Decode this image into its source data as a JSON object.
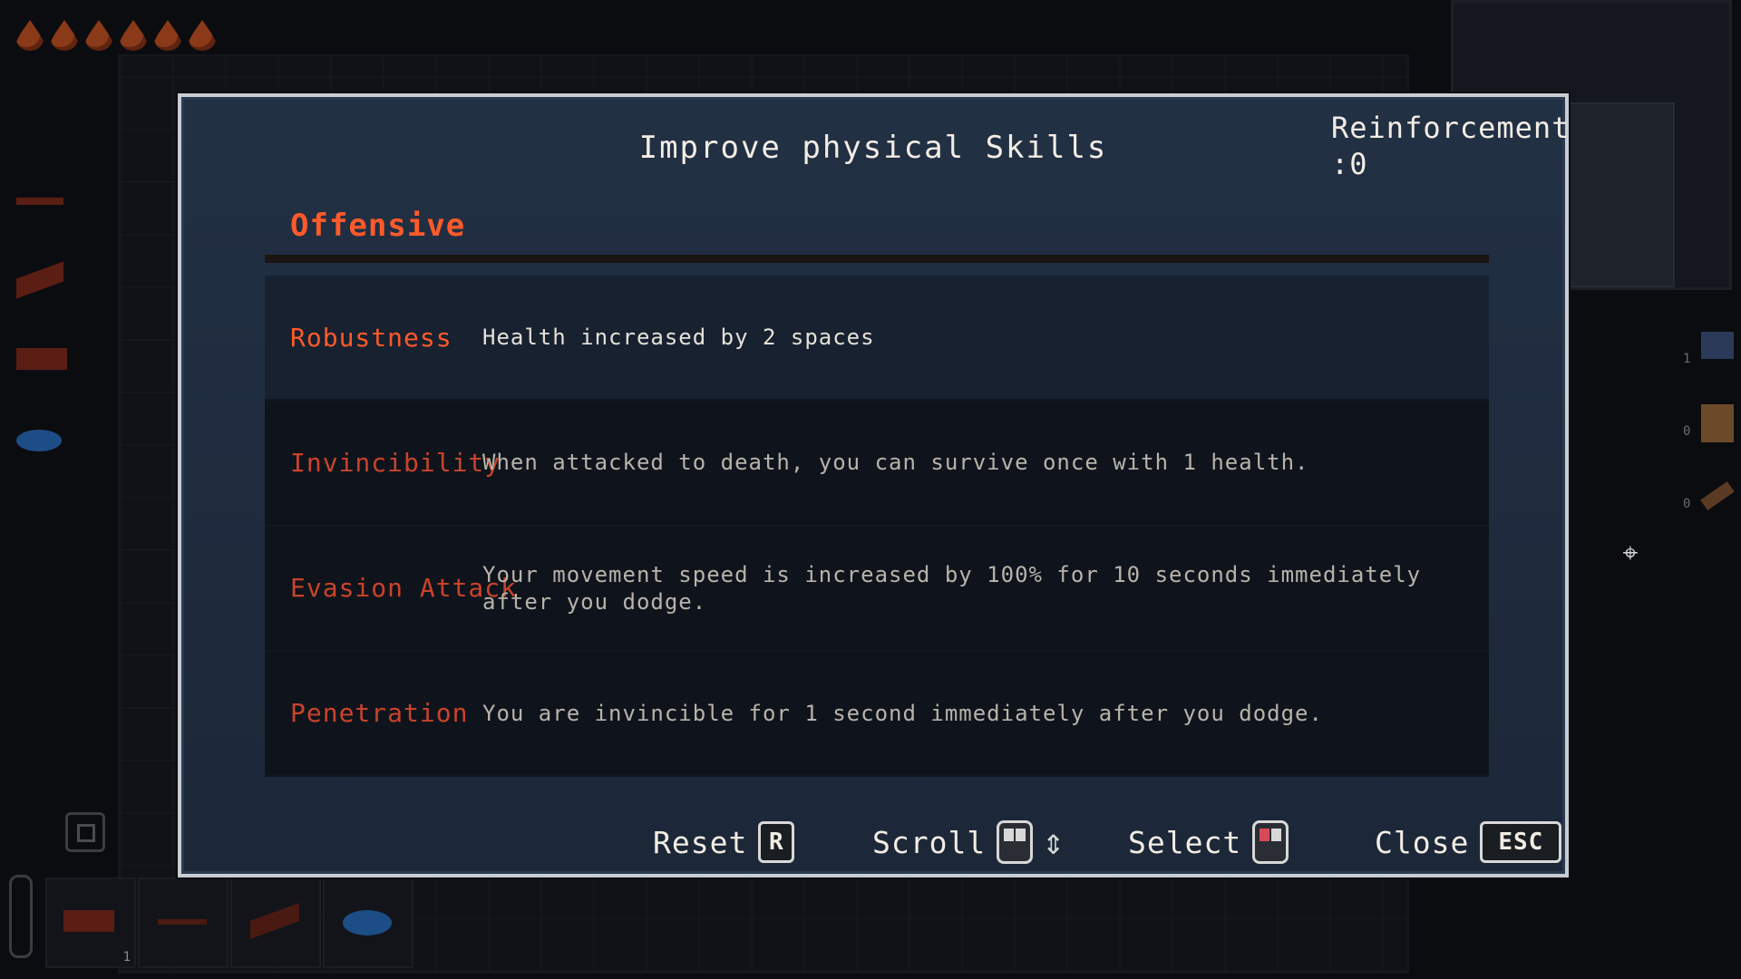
{
  "modal": {
    "title": "Improve physical Skills",
    "reinforcement_label": "Reinforcement",
    "reinforcement_value": ":0"
  },
  "section": {
    "title": "Offensive"
  },
  "skills": [
    {
      "name": "Robustness",
      "description": "Health increased by 2 spaces"
    },
    {
      "name": "Invincibility",
      "description": "When attacked to death, you can survive once with 1 health."
    },
    {
      "name": "Evasion Attack",
      "description": "Your movement speed is increased by 100% for 10 seconds immediately after you dodge."
    },
    {
      "name": "Penetration",
      "description": "You are invincible for 1 second immediately after you dodge."
    }
  ],
  "controls": {
    "reset_label": "Reset",
    "reset_key": "R",
    "scroll_label": "Scroll",
    "select_label": "Select",
    "close_label": "Close",
    "close_key": "ESC"
  },
  "hud": {
    "hearts": 6,
    "hotbar_count": "1",
    "side_item_counts": [
      "1",
      "0",
      "0"
    ]
  },
  "colors": {
    "accent": "#ff5a2a",
    "panel": "#1e2b3d",
    "mouse_active": "#d64a5a"
  }
}
